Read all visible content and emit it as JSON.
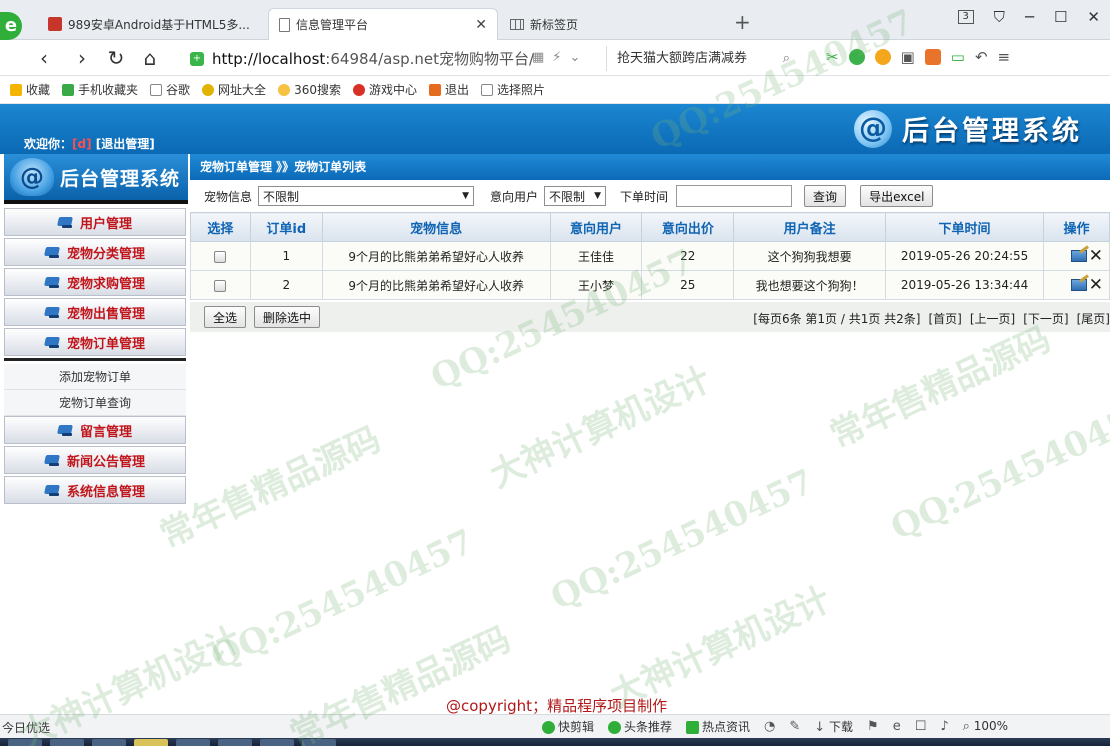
{
  "browser": {
    "tabs": [
      {
        "title": "989安卓Android基于HTML5多..."
      },
      {
        "title": "信息管理平台"
      },
      {
        "title": "新标签页"
      }
    ],
    "tab_count": "3",
    "url_host": "http://localhost",
    "url_rest": ":64984/asp.net宠物购物平台/",
    "search_text": "抢天猫大额跨店满减券",
    "bookmarks": [
      "收藏",
      "手机收藏夹",
      "谷歌",
      "网址大全",
      "360搜索",
      "游戏中心",
      "退出",
      "选择照片"
    ]
  },
  "header": {
    "welcome_label": "欢迎你：",
    "username": "[d]",
    "logout": "[退出管理]",
    "brand_logo": "@",
    "brand_text": "后台管理系统"
  },
  "sidebar": {
    "brand_text": "后台管理系统",
    "menus": [
      {
        "label": "用户管理"
      },
      {
        "label": "宠物分类管理"
      },
      {
        "label": "宠物求购管理"
      },
      {
        "label": "宠物出售管理"
      },
      {
        "label": "宠物订单管理"
      },
      {
        "label": "留言管理"
      },
      {
        "label": "新闻公告管理"
      },
      {
        "label": "系统信息管理"
      }
    ],
    "submenus": [
      {
        "label": "添加宠物订单"
      },
      {
        "label": "宠物订单查询"
      }
    ]
  },
  "breadcrumb": "宠物订单管理 》》宠物订单列表",
  "filters": {
    "pet_label": "宠物信息",
    "pet_value": "不限制",
    "user_label": "意向用户",
    "user_value": "不限制",
    "time_label": "下单时间",
    "time_value": "",
    "search_btn": "查询",
    "export_btn": "导出excel"
  },
  "table": {
    "columns": [
      "选择",
      "订单id",
      "宠物信息",
      "意向用户",
      "意向出价",
      "用户备注",
      "下单时间",
      "操作"
    ],
    "rows": [
      {
        "id": "1",
        "pet": "9个月的比熊弟弟希望好心人收养",
        "user": "王佳佳",
        "price": "22",
        "note": "这个狗狗我想要",
        "time": "2019-05-26 20:24:55"
      },
      {
        "id": "2",
        "pet": "9个月的比熊弟弟希望好心人收养",
        "user": "王小梦",
        "price": "25",
        "note": "我也想要这个狗狗！",
        "time": "2019-05-26 13:34:44"
      }
    ]
  },
  "actions": {
    "select_all": "全选",
    "delete_selected": "删除选中",
    "pager_info": "[每页6条 第1页 / 共1页 共2条]",
    "first": "[首页]",
    "prev": "[上一页]",
    "next": "[下一页]",
    "last": "[尾页]"
  },
  "copyright": "@copyright；精品程序项目制作",
  "statusbar": {
    "left": "今日优选",
    "items": [
      "快剪辑",
      "头条推荐",
      "热点资讯",
      "下载"
    ],
    "zoom": "100%"
  },
  "watermark": {
    "qq": "QQ:254540457",
    "t1": "常年售精品源码",
    "t2": "大神计算机设计"
  }
}
